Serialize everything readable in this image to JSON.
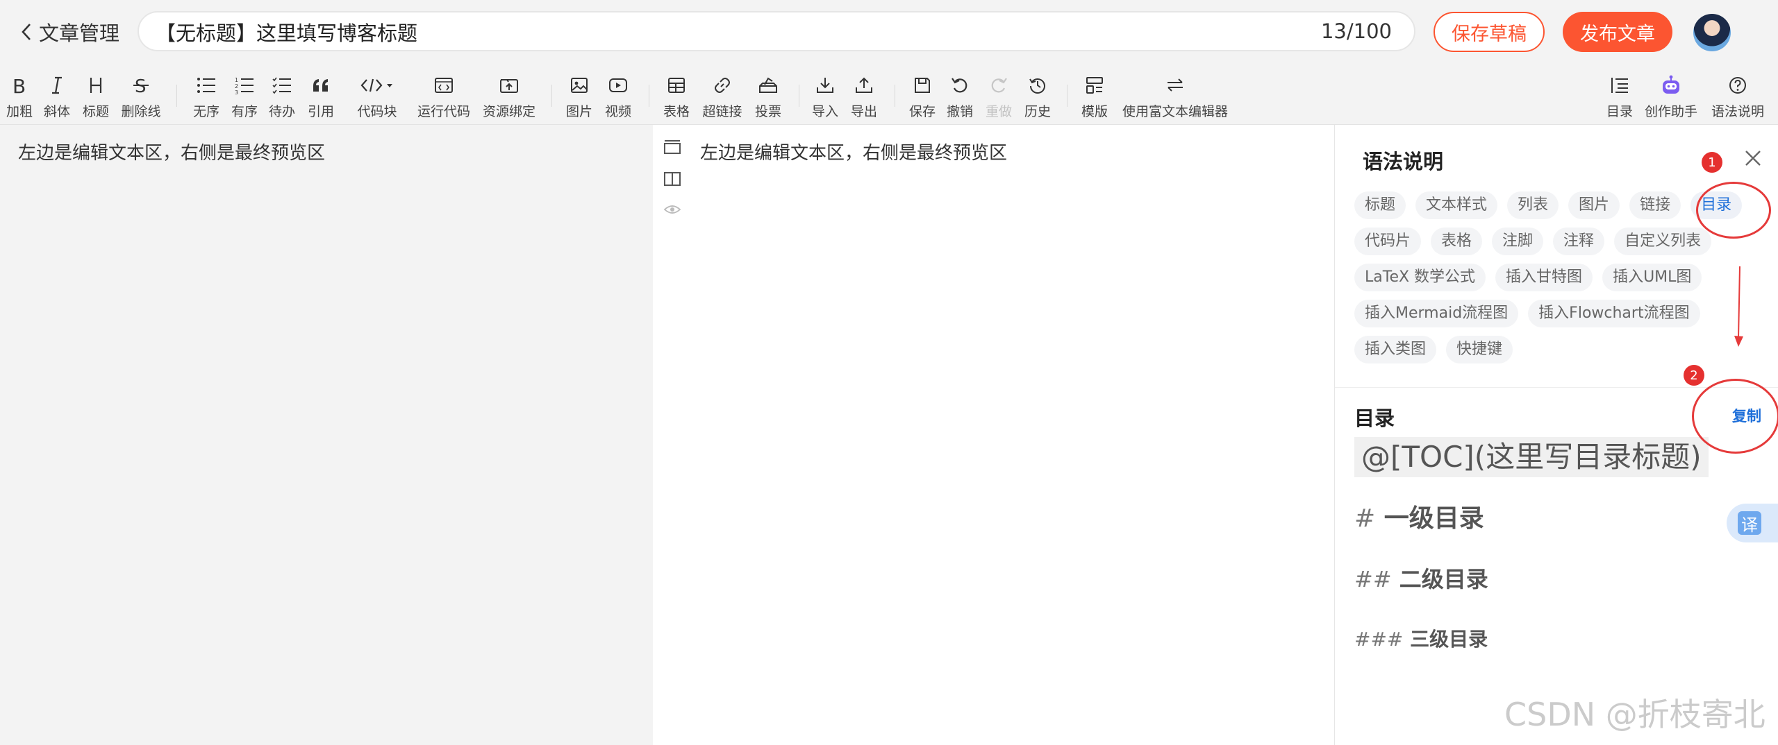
{
  "header": {
    "back_label": "文章管理",
    "title_value": "【无标题】这里填写博客标题",
    "title_counter": "13/100",
    "save_draft_label": "保存草稿",
    "publish_label": "发布文章"
  },
  "toolbar": {
    "bold": "加粗",
    "italic": "斜体",
    "heading": "标题",
    "strikethrough": "删除线",
    "unordered": "无序",
    "ordered": "有序",
    "todo": "待办",
    "quote": "引用",
    "codeblock": "代码块",
    "run_code": "运行代码",
    "resource": "资源绑定",
    "image": "图片",
    "video": "视频",
    "table": "表格",
    "link": "超链接",
    "vote": "投票",
    "import": "导入",
    "export": "导出",
    "save": "保存",
    "undo": "撤销",
    "redo": "重做",
    "history": "历史",
    "template": "模版",
    "rich_text": "使用富文本编辑器",
    "toc": "目录",
    "assistant": "创作助手",
    "grammar": "语法说明"
  },
  "editor": {
    "left_text": "左边是编辑文本区，右侧是最终预览区",
    "preview_text": "左边是编辑文本区，右侧是最终预览区"
  },
  "grammar_panel": {
    "title": "语法说明",
    "tags": [
      "标题",
      "文本样式",
      "列表",
      "图片",
      "链接",
      "目录",
      "代码片",
      "表格",
      "注脚",
      "注释",
      "自定义列表",
      "LaTeX 数学公式",
      "插入甘特图",
      "插入UML图",
      "插入Mermaid流程图",
      "插入Flowchart流程图",
      "插入类图",
      "快捷键"
    ],
    "active_tag": "目录",
    "section_title": "目录",
    "copy_label": "复制",
    "toc_code": "@[TOC](这里写目录标题)",
    "h1_marker": "#",
    "h1_text": "一级目录",
    "h2_marker": "##",
    "h2_text": "二级目录",
    "h3_marker": "###",
    "h3_text": "三级目录"
  },
  "translate_label": "译",
  "annotations": {
    "badge1": "1",
    "badge2": "2"
  },
  "watermark": "CSDN @折枝寄北",
  "colors": {
    "accent": "#fc5531",
    "link_blue": "#1e6fd9",
    "annotation_red": "#e53a3a"
  }
}
